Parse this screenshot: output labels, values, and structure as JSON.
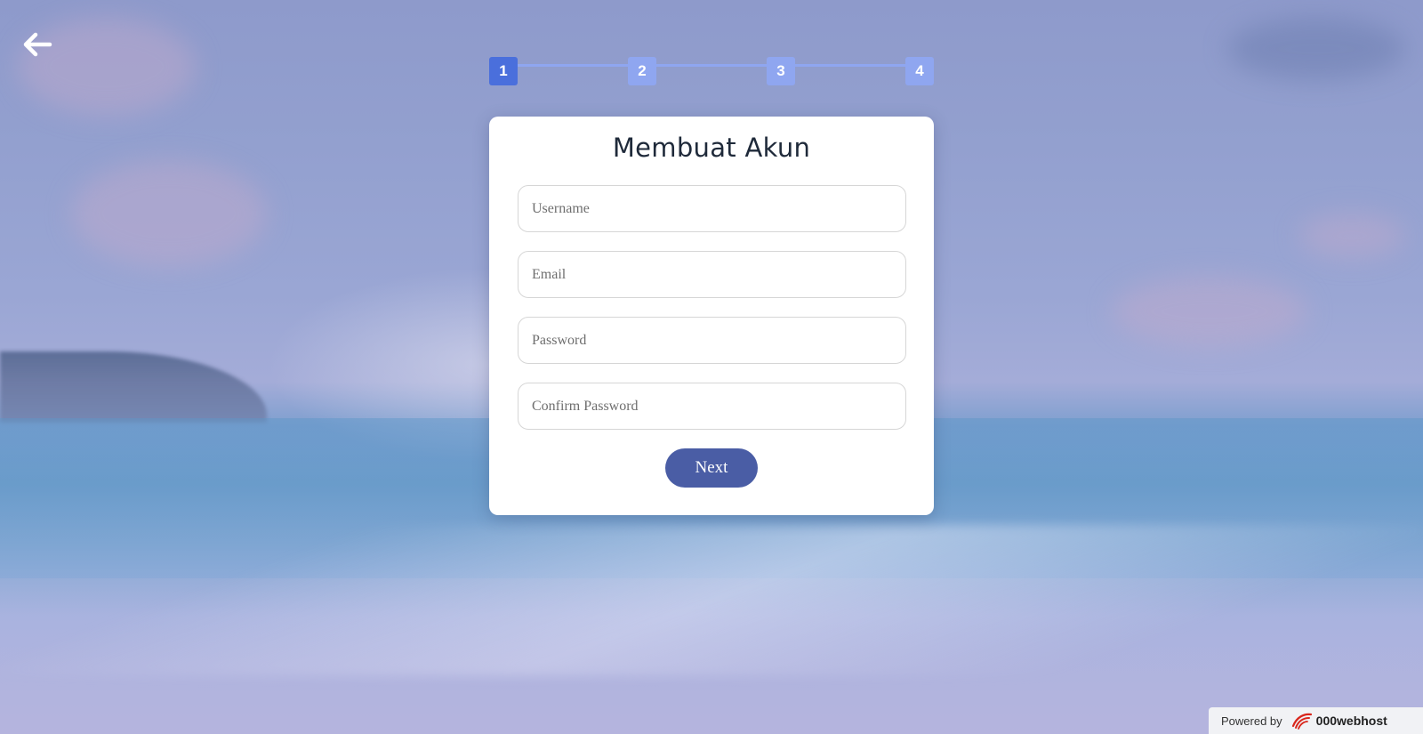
{
  "header": {
    "back_icon": "arrow-left-icon"
  },
  "stepper": {
    "steps": [
      "1",
      "2",
      "3",
      "4"
    ],
    "active_step": 1,
    "colors": {
      "active": "#4a6fdc",
      "inactive": "#8fa6f0"
    }
  },
  "form": {
    "title": "Membuat Akun",
    "username_placeholder": "Username",
    "email_placeholder": "Email",
    "password_placeholder": "Password",
    "confirm_password_placeholder": "Confirm Password",
    "next_label": "Next",
    "accent_color": "#4a5da5"
  },
  "footer": {
    "powered_by": "Powered by",
    "brand": "000webhost",
    "logo_icon": "000webhost-logo-icon"
  }
}
